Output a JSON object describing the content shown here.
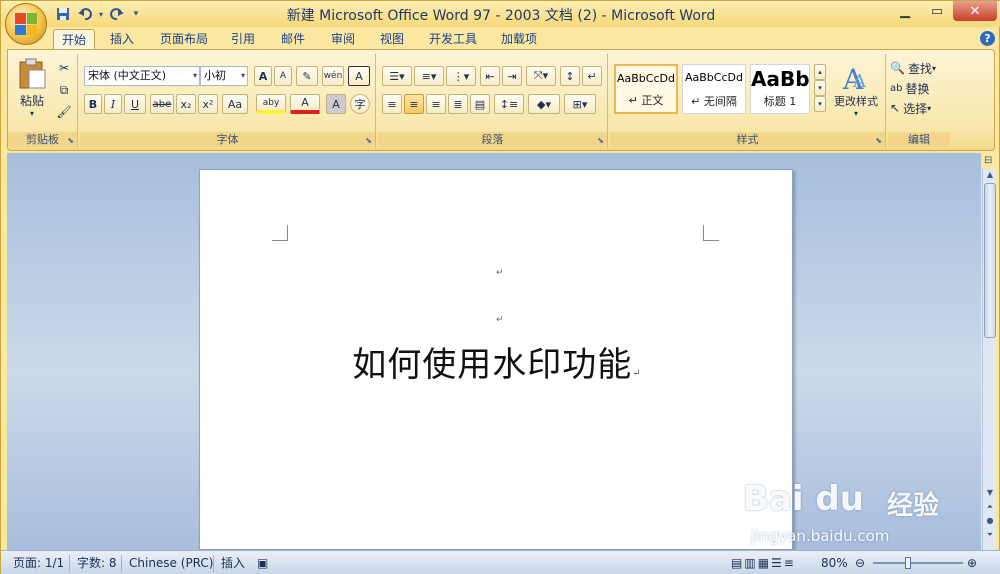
{
  "window": {
    "title": "新建 Microsoft Office Word 97 - 2003 文档 (2) - Microsoft Word",
    "minimize_icon": "minimize-icon",
    "maximize_icon": "maximize-icon",
    "close_glyph": "✕"
  },
  "qat": {
    "save_icon": "save-icon",
    "undo_icon": "undo-icon",
    "redo_icon": "redo-icon",
    "customize_icon": "dropdown-icon"
  },
  "tabs": [
    {
      "label": "开始",
      "active": true
    },
    {
      "label": "插入"
    },
    {
      "label": "页面布局"
    },
    {
      "label": "引用"
    },
    {
      "label": "邮件"
    },
    {
      "label": "审阅"
    },
    {
      "label": "视图"
    },
    {
      "label": "开发工具"
    },
    {
      "label": "加载项"
    }
  ],
  "ribbon": {
    "clipboard": {
      "label": "剪贴板",
      "paste_label": "粘贴"
    },
    "font": {
      "label": "字体",
      "font_name": "宋体 (中文正文)",
      "font_size": "小初",
      "bold": "B",
      "italic": "I",
      "underline": "U",
      "strike": "abe",
      "sub": "x₂",
      "sup": "x²",
      "case": "Aa",
      "highlight": "aby",
      "fontcolor": "A",
      "charshade": "A",
      "enclose": "字",
      "grow": "A",
      "shrink": "A",
      "clear": "A"
    },
    "paragraph": {
      "label": "段落"
    },
    "styles": {
      "label": "样式",
      "items": [
        {
          "sample": "AaBbCcDd",
          "name": "↵ 正文"
        },
        {
          "sample": "AaBbCcDd",
          "name": "↵ 无间隔"
        },
        {
          "sample": "AaBb",
          "name": "标题 1"
        }
      ],
      "change_label": "更改样式"
    },
    "editing": {
      "label": "编辑",
      "find": "查找",
      "replace": "替换",
      "select": "选择"
    }
  },
  "document": {
    "para1": "↵",
    "para2": "↵",
    "heading": "如何使用水印功能",
    "heading_mark": "↵"
  },
  "statusbar": {
    "page": "页面: 1/1",
    "words": "字数: 8",
    "language": "Chinese (PRC)",
    "mode": "插入",
    "zoom": "80%"
  },
  "watermark": {
    "logo": "Bai du",
    "text": "经验",
    "url": "jingyan.baidu.com"
  },
  "colors": {
    "frame": "#fce7a0",
    "doc_bg": "#a6bfdc",
    "text": "#15428b"
  }
}
